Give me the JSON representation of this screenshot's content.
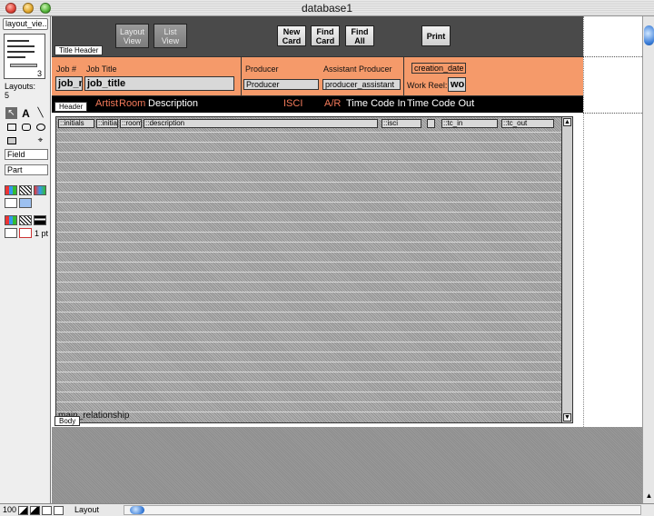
{
  "window": {
    "title": "database1"
  },
  "toolpanel": {
    "layout_popup": "layout_vie...",
    "flipbook_page": "3",
    "layouts_label": "Layouts:",
    "layouts_count": "5",
    "text_tool": "A",
    "field_popup": "Field",
    "part_popup": "Part",
    "line_width": "1 pt"
  },
  "toolbar": {
    "layout_view": "Layout View",
    "list_view": "List View",
    "new_card": "New Card",
    "find_card": "Find Card",
    "find_all": "Find All",
    "print": "Print"
  },
  "parts": {
    "title_header": "Title Header",
    "header": "Header",
    "body": "Body"
  },
  "header_fields": {
    "job_num_label": "Job #",
    "job_title_label": "Job Title",
    "producer_label": "Producer",
    "assistant_producer_label": "Assistant Producer",
    "job_num_field": "job_n",
    "job_title_field": "job_title",
    "producer_field": "Producer",
    "assistant_field": "producer_assistant",
    "creation_date_field": "creation_date",
    "work_reel_label": "Work Reel:",
    "work_reel_field": "wo"
  },
  "column_headers": {
    "artist": "Artist",
    "room": "Room",
    "description": "Description",
    "isci": "ISCI",
    "ar": "A/R",
    "tc_in": "Time Code In",
    "tc_out": "Time Code Out"
  },
  "portal": {
    "fields": [
      "::initials",
      "::initial",
      "::room",
      "::description",
      "::isci",
      "",
      "::tc_in",
      "::tc_out"
    ],
    "name": "main_relationship"
  },
  "statusbar": {
    "zoom": "100",
    "mode": "Layout"
  },
  "colors": {
    "header_band": "#f59a6a",
    "toolbar": "#4a4a4a",
    "column_header": "#000000",
    "isci_color": "#f47a5a",
    "artist_color": "#f47a5a"
  }
}
